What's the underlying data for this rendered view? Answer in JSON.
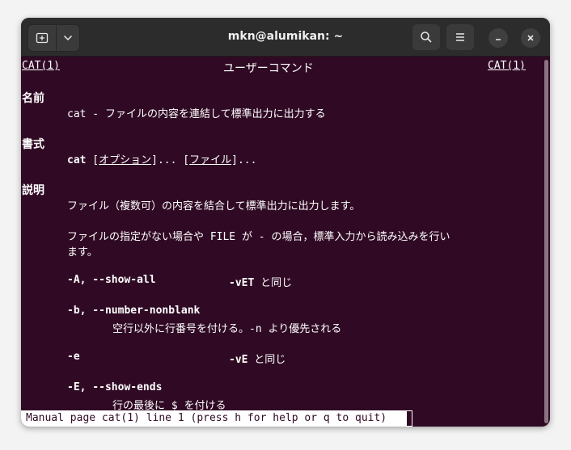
{
  "window": {
    "title": "mkn@alumikan: ~"
  },
  "header": {
    "left": "CAT(1)",
    "center": "ユーザーコマンド",
    "right": "CAT(1)"
  },
  "sections": {
    "name_heading": "名前",
    "name_line": "cat - ファイルの内容を連結して標準出力に出力する",
    "synopsis_heading": "書式",
    "synopsis_cmd": "cat",
    "synopsis_open1": " [",
    "synopsis_opt": "オプション",
    "synopsis_close1": "]... [",
    "synopsis_file": "ファイル",
    "synopsis_close2": "]...",
    "desc_heading": "説明",
    "desc_p1": "ファイル（複数可）の内容を結合して標準出力に出力します。",
    "desc_p2a": "ファイルの指定がない場合や FILE が - の場合，標準入力から読み込みを行い",
    "desc_p2b": "ます。",
    "opt_A_flag": "-A, --show-all",
    "opt_A_eq": "-vET",
    "opt_A_same": " と同じ",
    "opt_b_flag": "-b, --number-nonblank",
    "opt_b_desc": "空行以外に行番号を付ける。-n より優先される",
    "opt_e_flag": "-e",
    "opt_e_eq": "-vE",
    "opt_e_same": " と同じ",
    "opt_E_flag": "-E, --show-ends",
    "opt_E_desc": "行の最後に $ を付ける"
  },
  "status": "Manual page cat(1) line 1 (press h for help or q to quit)"
}
